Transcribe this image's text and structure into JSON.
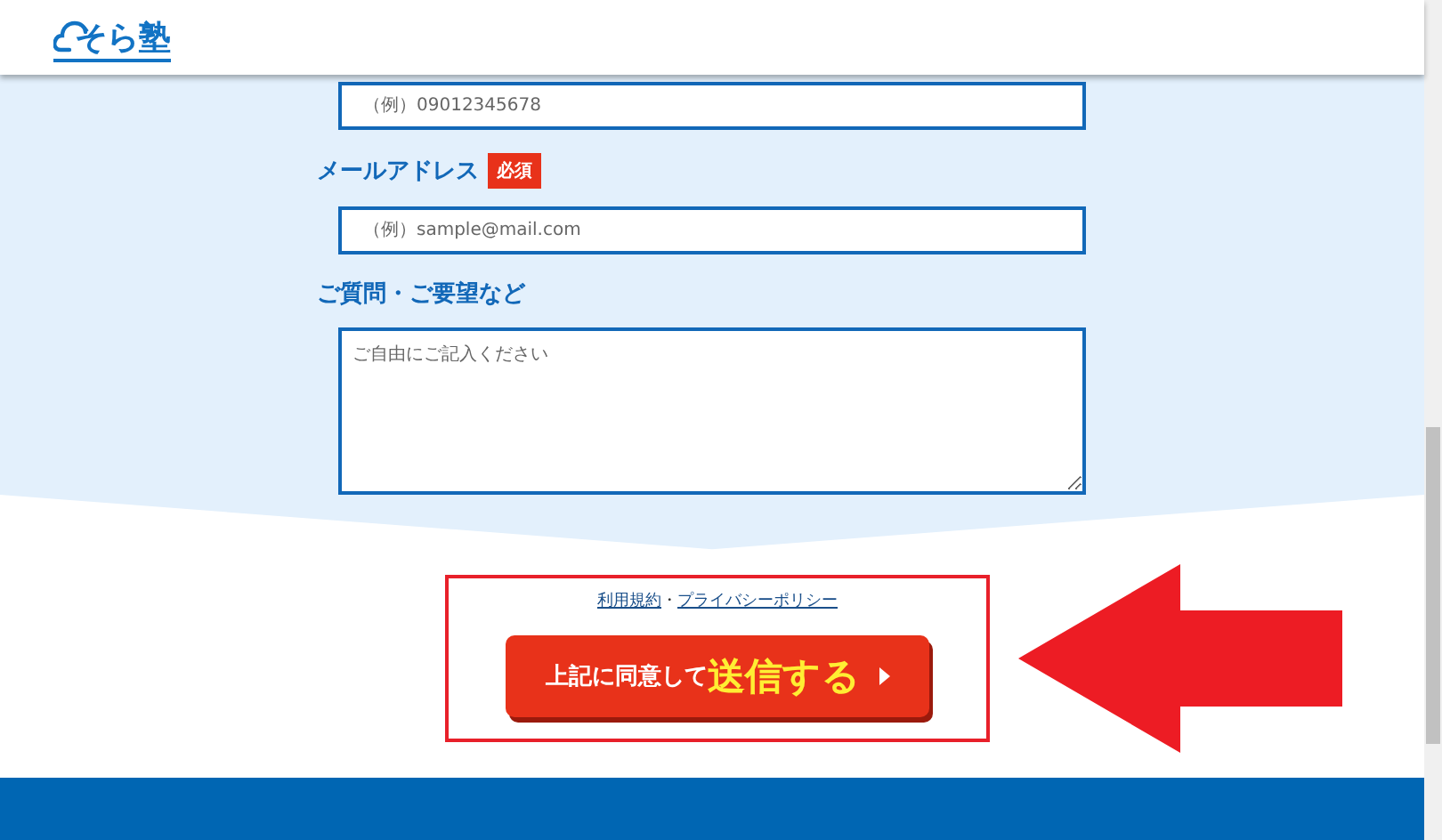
{
  "header": {
    "logo": "そら塾"
  },
  "form": {
    "fields": [
      {
        "kind": "input",
        "placeholder": "（例）09012345678"
      },
      {
        "kind": "label",
        "label": "メールアドレス",
        "badge": "必須"
      },
      {
        "kind": "input",
        "placeholder": "（例）sample@mail.com"
      },
      {
        "kind": "label",
        "label": "ご質問・ご要望など"
      },
      {
        "kind": "textarea",
        "placeholder": "ご自由にご記入ください"
      }
    ]
  },
  "consent": {
    "links": [
      "利用規約",
      "プライバシーポリシー"
    ],
    "separator": "・",
    "submit": {
      "lead": "上記に同意して",
      "main": "送信する"
    }
  }
}
